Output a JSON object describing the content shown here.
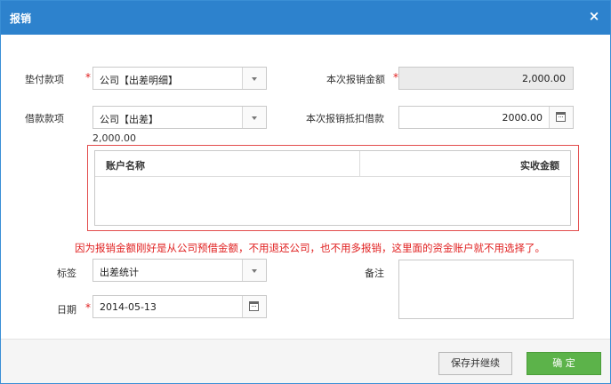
{
  "dialog": {
    "title": "报销",
    "close_glyph": "×"
  },
  "form": {
    "advance_item": {
      "label": "垫付款项",
      "value": "公司【出差明细】"
    },
    "reimburse_amount": {
      "label": "本次报销金额",
      "value": "2,000.00"
    },
    "loan_item": {
      "label": "借款款项",
      "value": "公司【出差】",
      "balance": "2,000.00"
    },
    "offset_loan": {
      "label": "本次报销抵扣借款",
      "value": "2000.00"
    },
    "grid": {
      "col_account": "账户名称",
      "col_amount": "实收金额"
    },
    "tag": {
      "label": "标签",
      "value": "出差统计"
    },
    "note": {
      "label": "备注",
      "value": ""
    },
    "date": {
      "label": "日期",
      "value": "2014-05-13"
    },
    "required_mark": "*"
  },
  "annotation": "因为报销金额刚好是从公司预借金额，不用退还公司，也不用多报销，这里面的资金账户就不用选择了。",
  "buttons": {
    "save_continue": "保存并继续",
    "confirm": "确 定"
  },
  "colors": {
    "titlebar": "#2d82cd",
    "confirm": "#5cb34a",
    "annotation": "#e02020"
  },
  "icons": [
    "close-icon",
    "chevron-down-icon",
    "calendar-icon"
  ]
}
